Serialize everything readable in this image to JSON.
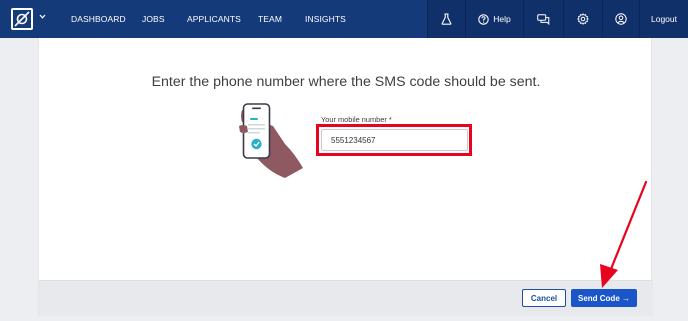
{
  "nav": {
    "items": [
      {
        "label": "DASHBOARD"
      },
      {
        "label": "JOBS"
      },
      {
        "label": "APPLICANTS"
      },
      {
        "label": "TEAM"
      },
      {
        "label": "INSIGHTS"
      }
    ],
    "help_label": "Help",
    "logout_label": "Logout",
    "icons": [
      "logo-icon",
      "chevron-down-icon",
      "flask-icon",
      "help-circle-icon",
      "chat-bubbles-icon",
      "gear-icon",
      "user-circle-icon"
    ]
  },
  "main": {
    "heading": "Enter the phone number where the SMS code should be sent.",
    "phone_field": {
      "label": "Your mobile number *",
      "value": "5551234567"
    }
  },
  "footer": {
    "cancel_label": "Cancel",
    "send_label": "Send Code →"
  },
  "colors": {
    "nav_bg": "#143a7a",
    "primary": "#1a56c9",
    "annotation": "#e8041f"
  }
}
